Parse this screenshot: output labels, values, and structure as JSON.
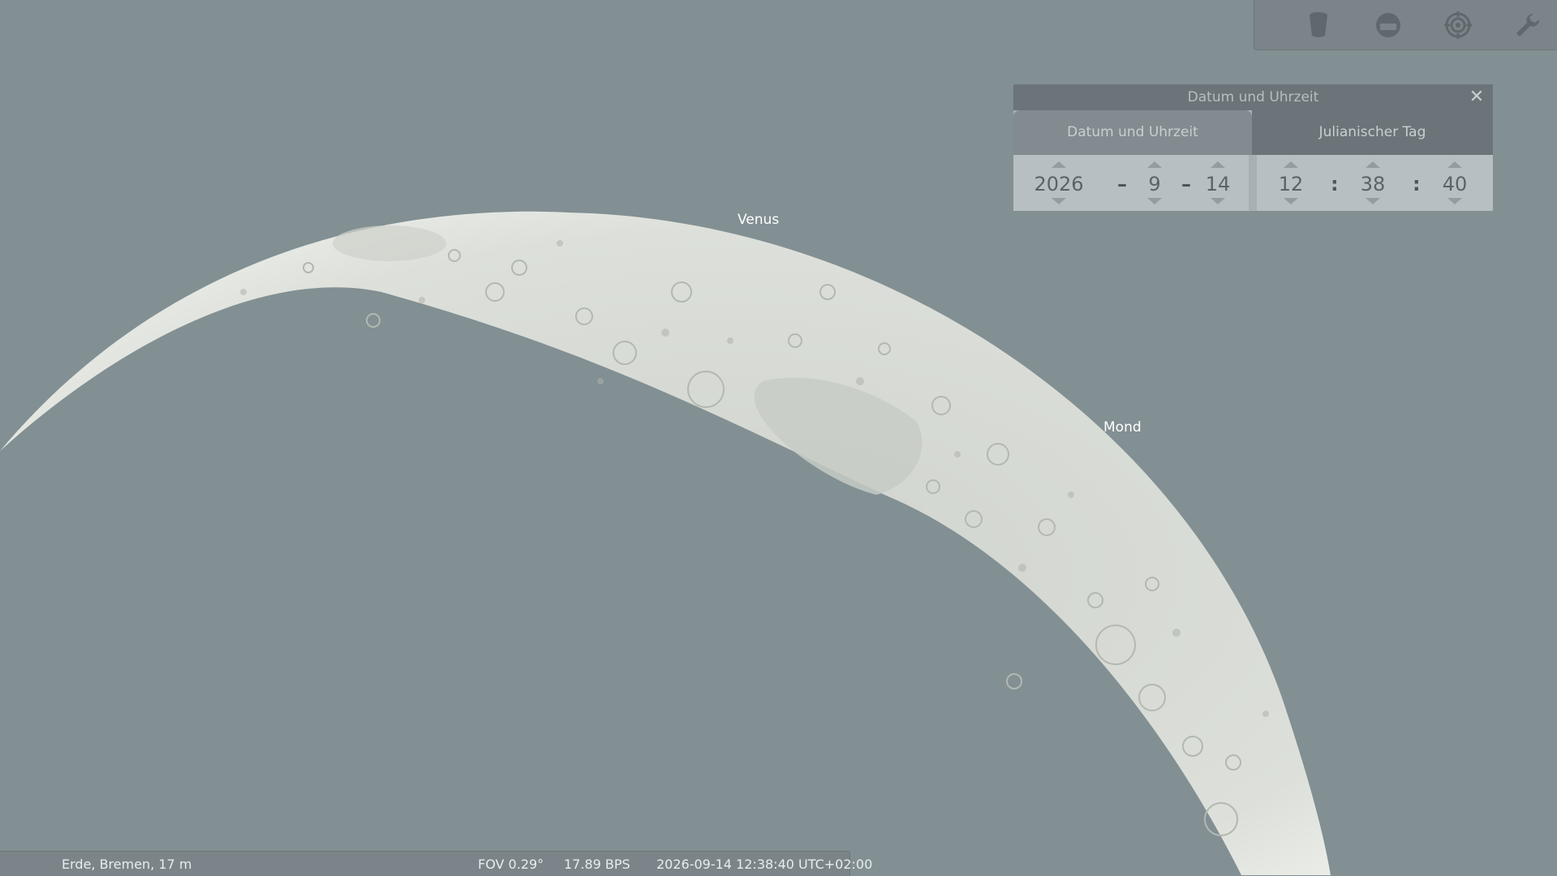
{
  "sky": {
    "labels": {
      "venus": "Venus",
      "moon": "Mond"
    },
    "background_color": "#828f93",
    "moon_color": "#dfe2dc"
  },
  "toolbar": {
    "items": [
      {
        "name": "bucket-icon"
      },
      {
        "name": "window-icon"
      },
      {
        "name": "target-icon"
      },
      {
        "name": "wrench-icon"
      }
    ]
  },
  "dialog": {
    "title": "Datum und Uhrzeit",
    "tabs": {
      "date_time": "Datum und Uhrzeit",
      "julian_day": "Julianischer Tag"
    },
    "date": {
      "year": "2026",
      "month": "9",
      "day": "14",
      "separator": "–"
    },
    "time": {
      "hour": "12",
      "minute": "38",
      "second": "40",
      "separator": ":"
    }
  },
  "statusbar": {
    "location": "Erde, Bremen, 17 m",
    "fov": "FOV 0.29°",
    "fps": "17.89 BPS",
    "datetime": "2026-09-14 12:38:40 UTC+02:00"
  }
}
